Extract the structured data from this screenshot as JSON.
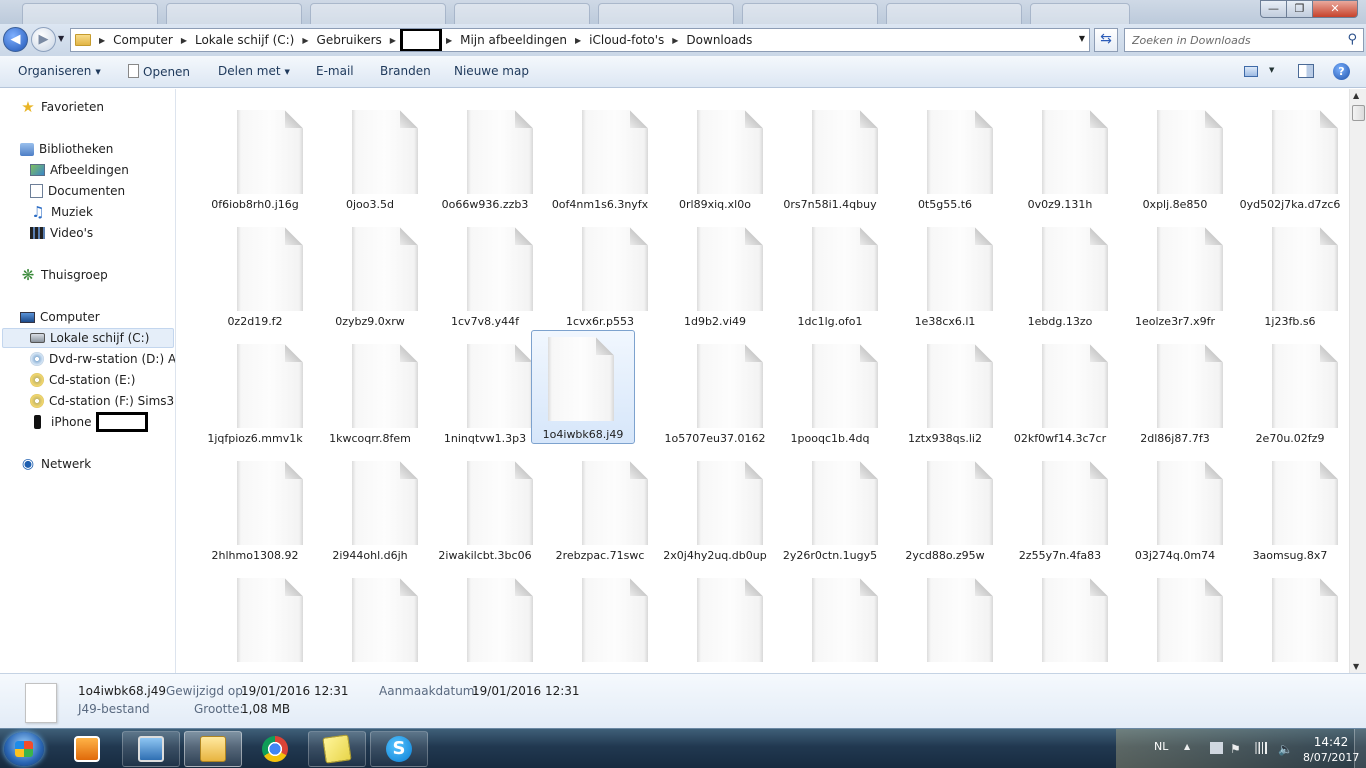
{
  "address": {
    "crumbs": [
      {
        "label": "Computer",
        "redacted": false
      },
      {
        "label": "Lokale schijf (C:)",
        "redacted": false
      },
      {
        "label": "Gebruikers",
        "redacted": false
      },
      {
        "label": "",
        "redacted": true
      },
      {
        "label": "Mijn afbeeldingen",
        "redacted": false
      },
      {
        "label": "iCloud-foto's",
        "redacted": false
      },
      {
        "label": "Downloads",
        "redacted": false
      }
    ]
  },
  "search": {
    "placeholder": "Zoeken in Downloads"
  },
  "toolbar": {
    "organize": "Organiseren",
    "open": "Openen",
    "share": "Delen met",
    "email": "E-mail",
    "burn": "Branden",
    "new_folder": "Nieuwe map"
  },
  "sidebar": {
    "favorites": "Favorieten",
    "libraries": "Bibliotheken",
    "library_items": [
      "Afbeeldingen",
      "Documenten",
      "Muziek",
      "Video's"
    ],
    "homegroup": "Thuisgroep",
    "computer": "Computer",
    "drives": [
      {
        "label": "Lokale schijf (C:)",
        "icon": "hard-drive-icon",
        "selected": true
      },
      {
        "label": "Dvd-rw-station (D:) Aud",
        "icon": "dvd-drive-icon",
        "selected": false
      },
      {
        "label": "Cd-station (E:)",
        "icon": "cd-drive-icon",
        "selected": false
      },
      {
        "label": "Cd-station (F:) Sims3",
        "icon": "cd-drive-icon",
        "selected": false
      }
    ],
    "iphone": "iPhone",
    "network": "Netwerk"
  },
  "files": [
    "0f6iob8rh0.j16g",
    "0joo3.5d",
    "0o66w936.zzb3",
    "0of4nm1s6.3nyfx",
    "0rl89xiq.xl0o",
    "0rs7n58i1.4qbuy",
    "0t5g55.t6",
    "0v0z9.131h",
    "0xplj.8e850",
    "0yd502j7ka.d7zc6",
    "0z2d19.f2",
    "0zybz9.0xrw",
    "1cv7v8.y44f",
    "1cvx6r.p553",
    "1d9b2.vi49",
    "1dc1lg.ofo1",
    "1e38cx6.l1",
    "1ebdg.13zo",
    "1eolze3r7.x9fr",
    "1j23fb.s6",
    "1jqfpioz6.mmv1k",
    "1kwcoqrr.8fem",
    "1ninqtvw1.3p3",
    "1o4iwbk68.j49",
    "1o5707eu37.0162",
    "1pooqc1b.4dq",
    "1ztx938qs.li2",
    "02kf0wf14.3c7cr",
    "2dl86j87.7f3",
    "2e70u.02fz9",
    "2hlhmo1308.92",
    "2i944ohl.d6jh",
    "2iwakilcbt.3bc06",
    "2rebzpac.71swc",
    "2x0j4hy2uq.db0up",
    "2y26r0ctn.1ugy5",
    "2ycd88o.z95w",
    "2z55y7n.4fa83",
    "03j274q.0m74",
    "3aomsug.8x7",
    "",
    "",
    "",
    "",
    "",
    "",
    "",
    "",
    "",
    ""
  ],
  "selected_file": "1o4iwbk68.j49",
  "details": {
    "name": "1o4iwbk68.j49",
    "type": "J49-bestand",
    "modified_label": "Gewijzigd op:",
    "modified_value": "19/01/2016 12:31",
    "size_label": "Grootte:",
    "size_value": "1,08 MB",
    "created_label": "Aanmaakdatum:",
    "created_value": "19/01/2016 12:31"
  },
  "taskbar": {
    "apps": [
      {
        "name": "media-player",
        "active": false
      },
      {
        "name": "task-manager",
        "active": false
      },
      {
        "name": "windows-explorer",
        "active": true
      },
      {
        "name": "chrome",
        "active": false
      },
      {
        "name": "sticky-notes",
        "active": false
      },
      {
        "name": "skype",
        "active": false
      }
    ],
    "language": "NL",
    "time": "14:42",
    "date": "8/07/2017"
  }
}
